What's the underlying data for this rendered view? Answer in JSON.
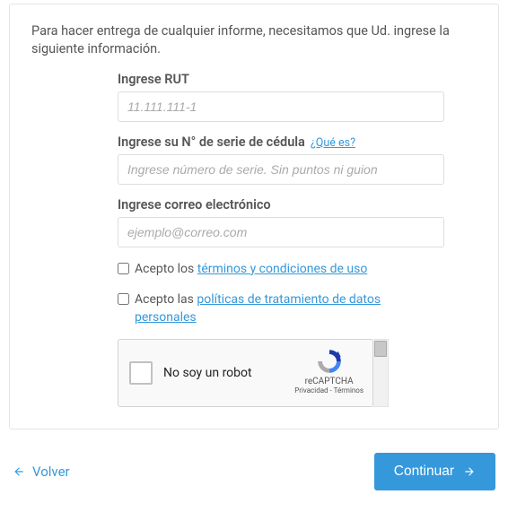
{
  "intro": "Para hacer entrega de cualquier informe, necesitamos que Ud. ingrese la siguiente información.",
  "fields": {
    "rut": {
      "label": "Ingrese RUT",
      "placeholder": "11.111.111-1"
    },
    "serie": {
      "label": "Ingrese su N° de serie de cédula",
      "help": "¿Qué es?",
      "placeholder": "Ingrese número de serie. Sin puntos ni guion"
    },
    "email": {
      "label": "Ingrese correo electrónico",
      "placeholder": "ejemplo@correo.com"
    }
  },
  "checks": {
    "terms": {
      "prefix": "Acepto los ",
      "link": "términos y condiciones de uso"
    },
    "privacy": {
      "prefix": "Acepto las ",
      "link": "políticas de tratamiento de datos personales"
    }
  },
  "recaptcha": {
    "label": "No soy un robot",
    "brand": "reCAPTCHA",
    "links": "Privacidad - Términos"
  },
  "actions": {
    "back": "Volver",
    "continue": "Continuar"
  }
}
